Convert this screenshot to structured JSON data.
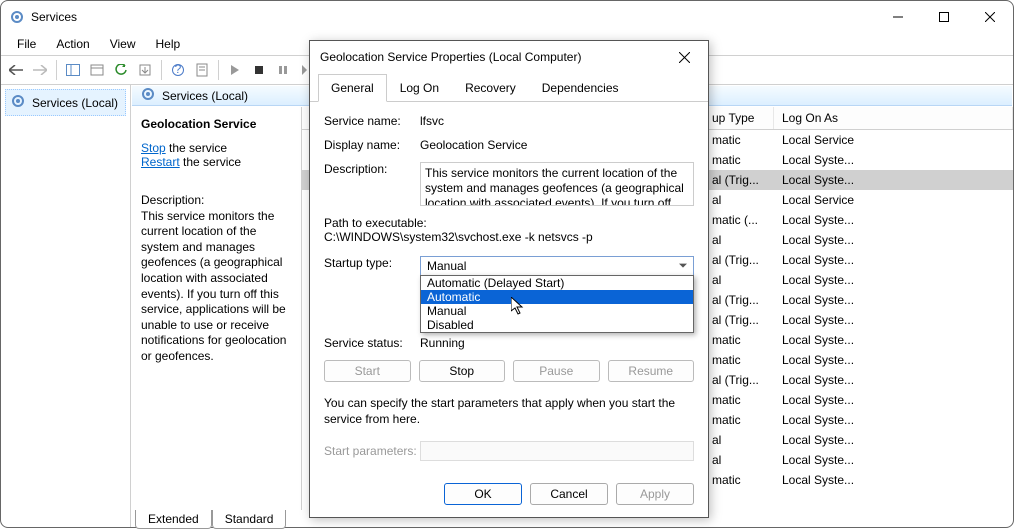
{
  "window": {
    "title": "Services",
    "menu": {
      "file": "File",
      "action": "Action",
      "view": "View",
      "help": "Help"
    }
  },
  "leftnav": {
    "item": "Services (Local)"
  },
  "content_header": "Services (Local)",
  "detail": {
    "title": "Geolocation Service",
    "stop_link": "Stop",
    "stop_after": " the service",
    "restart_link": "Restart",
    "restart_after": " the service",
    "desc_label": "Description:",
    "desc_text": "This service monitors the current location of the system and manages geofences (a geographical location with associated events).  If you turn off this service, applications will be unable to use or receive notifications for geolocation or geofences."
  },
  "list": {
    "col_type": "up Type",
    "col_logon": "Log On As",
    "rows": [
      {
        "type": "matic",
        "logon": "Local Service",
        "sel": false
      },
      {
        "type": "matic",
        "logon": "Local Syste...",
        "sel": false
      },
      {
        "type": "al (Trig...",
        "logon": "Local Syste...",
        "sel": true
      },
      {
        "type": "al",
        "logon": "Local Service",
        "sel": false
      },
      {
        "type": "matic (...",
        "logon": "Local Syste...",
        "sel": false
      },
      {
        "type": "al",
        "logon": "Local Syste...",
        "sel": false
      },
      {
        "type": "al (Trig...",
        "logon": "Local Syste...",
        "sel": false
      },
      {
        "type": "al",
        "logon": "Local Syste...",
        "sel": false
      },
      {
        "type": "al (Trig...",
        "logon": "Local Syste...",
        "sel": false
      },
      {
        "type": "al (Trig...",
        "logon": "Local Syste...",
        "sel": false
      },
      {
        "type": "matic",
        "logon": "Local Syste...",
        "sel": false
      },
      {
        "type": "matic",
        "logon": "Local Syste...",
        "sel": false
      },
      {
        "type": "al (Trig...",
        "logon": "Local Syste...",
        "sel": false
      },
      {
        "type": "matic",
        "logon": "Local Syste...",
        "sel": false
      },
      {
        "type": "matic",
        "logon": "Local Syste...",
        "sel": false
      },
      {
        "type": "al",
        "logon": "Local Syste...",
        "sel": false
      },
      {
        "type": "al",
        "logon": "Local Syste...",
        "sel": false
      },
      {
        "type": "matic",
        "logon": "Local Syste...",
        "sel": false
      }
    ]
  },
  "bottom_tabs": {
    "extended": "Extended",
    "standard": "Standard"
  },
  "dialog": {
    "title": "Geolocation Service Properties (Local Computer)",
    "tabs": {
      "general": "General",
      "logon": "Log On",
      "recovery": "Recovery",
      "dependencies": "Dependencies"
    },
    "labels": {
      "service_name": "Service name:",
      "display_name": "Display name:",
      "description": "Description:",
      "path": "Path to executable:",
      "startup": "Startup type:",
      "status": "Service status:",
      "start_params": "Start parameters:"
    },
    "values": {
      "service_name": "lfsvc",
      "display_name": "Geolocation Service",
      "description": "This service monitors the current location of the system and manages geofences (a geographical location with associated events).  If you turn off this",
      "path": "C:\\WINDOWS\\system32\\svchost.exe -k netsvcs -p",
      "startup_current": "Manual",
      "status": "Running"
    },
    "options": {
      "auto_delayed": "Automatic (Delayed Start)",
      "automatic": "Automatic",
      "manual": "Manual",
      "disabled": "Disabled"
    },
    "buttons": {
      "start": "Start",
      "stop": "Stop",
      "pause": "Pause",
      "resume": "Resume",
      "note": "You can specify the start parameters that apply when you start the service from here.",
      "ok": "OK",
      "cancel": "Cancel",
      "apply": "Apply"
    }
  }
}
